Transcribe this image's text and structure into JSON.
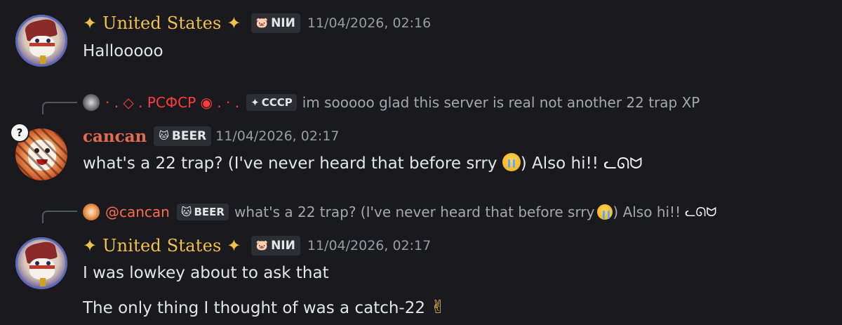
{
  "messages": [
    {
      "author": "✦ United States ✦",
      "tag_icon": "🐷",
      "tag": "NIИ",
      "timestamp": "11/04/2026, 02:16",
      "lines": [
        "Hallooooo"
      ]
    },
    {
      "reply": {
        "author": "· . ◇ . РСФСР ◉ . · .",
        "tag_icon": "✦",
        "tag": "СССР",
        "text": "im sooooo glad this server is real not another 22 trap XP"
      },
      "author": "cancan",
      "tag_icon": "🐱",
      "tag": "BEER",
      "timestamp": "11/04/2026, 02:17",
      "lines": [
        "what's a 22 trap? (I've never heard that before srry",
        ") Also hi!!"
      ]
    },
    {
      "reply": {
        "author": "@cancan",
        "tag_icon": "🐱",
        "tag": "BEER",
        "text_a": "what's a 22 trap? (I've never heard that before srry",
        "text_b": ") Also hi!!"
      },
      "author": "✦ United States ✦",
      "tag_icon": "🐷",
      "tag": "NIИ",
      "timestamp": "11/04/2026, 02:17",
      "lines": [
        "I was lowkey about to ask that",
        "The only thing I thought of was a catch-22"
      ]
    }
  ],
  "icons": {
    "cry": "loudly-crying-face",
    "cat": "white-cat-emote",
    "peace": "✌"
  },
  "badge_char": "?"
}
